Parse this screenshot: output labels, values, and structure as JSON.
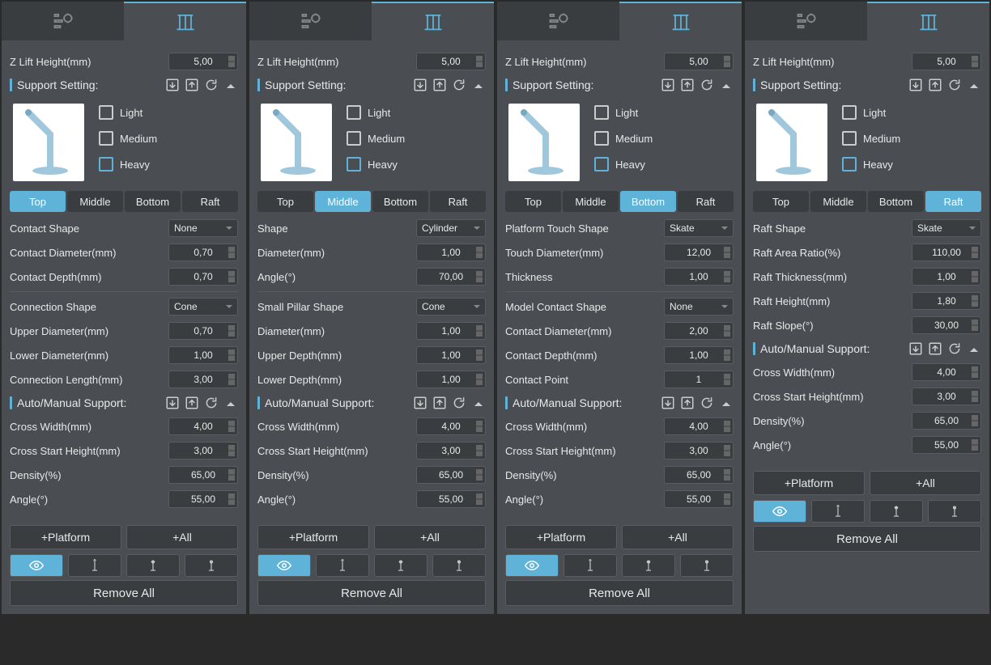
{
  "common": {
    "z_lift_label": "Z Lift Height(mm)",
    "z_lift_value": "5,00",
    "support_setting_label": "Support Setting:",
    "light": "Light",
    "medium": "Medium",
    "heavy": "Heavy",
    "tabs": {
      "top": "Top",
      "middle": "Middle",
      "bottom": "Bottom",
      "raft": "Raft"
    },
    "auto_manual_label": "Auto/Manual Support:",
    "cross_width_label": "Cross Width(mm)",
    "cross_width_value": "4,00",
    "cross_start_label": "Cross Start Height(mm)",
    "cross_start_value": "3,00",
    "density_label": "Density(%)",
    "density_value": "65,00",
    "angle_label": "Angle(°)",
    "angle_value": "55,00",
    "btn_platform": "+Platform",
    "btn_all": "+All",
    "btn_remove": "Remove All"
  },
  "panels": [
    {
      "active_tab": "top",
      "fields": [
        {
          "label": "Contact Shape",
          "type": "select",
          "value": "None"
        },
        {
          "label": "Contact Diameter(mm)",
          "type": "spin",
          "value": "0,70"
        },
        {
          "label": "Contact Depth(mm)",
          "type": "spin",
          "value": "0,70"
        },
        {
          "divider": true
        },
        {
          "label": "Connection Shape",
          "type": "select",
          "value": "Cone"
        },
        {
          "label": "Upper Diameter(mm)",
          "type": "spin",
          "value": "0,70"
        },
        {
          "label": "Lower Diameter(mm)",
          "type": "spin",
          "value": "1,00"
        },
        {
          "label": "Connection Length(mm)",
          "type": "spin",
          "value": "3,00"
        }
      ]
    },
    {
      "active_tab": "middle",
      "fields": [
        {
          "label": "Shape",
          "type": "select",
          "value": "Cylinder"
        },
        {
          "label": "Diameter(mm)",
          "type": "spin",
          "value": "1,00"
        },
        {
          "label": "Angle(°)",
          "type": "spin",
          "value": "70,00"
        },
        {
          "divider": true
        },
        {
          "label": "Small Pillar Shape",
          "type": "select",
          "value": "Cone"
        },
        {
          "label": "Diameter(mm)",
          "type": "spin",
          "value": "1,00"
        },
        {
          "label": "Upper Depth(mm)",
          "type": "spin",
          "value": "1,00"
        },
        {
          "label": "Lower Depth(mm)",
          "type": "spin",
          "value": "1,00"
        }
      ]
    },
    {
      "active_tab": "bottom",
      "fields": [
        {
          "label": "Platform Touch Shape",
          "type": "select",
          "value": "Skate"
        },
        {
          "label": "Touch Diameter(mm)",
          "type": "spin",
          "value": "12,00"
        },
        {
          "label": "Thickness",
          "type": "spin",
          "value": "1,00"
        },
        {
          "divider": true
        },
        {
          "label": "Model Contact Shape",
          "type": "select",
          "value": "None"
        },
        {
          "label": "Contact Diameter(mm)",
          "type": "spin",
          "value": "2,00"
        },
        {
          "label": "Contact Depth(mm)",
          "type": "spin",
          "value": "1,00"
        },
        {
          "label": "Contact Point",
          "type": "spin",
          "value": "1"
        }
      ]
    },
    {
      "active_tab": "raft",
      "fields": [
        {
          "label": "Raft Shape",
          "type": "select",
          "value": "Skate"
        },
        {
          "label": "Raft Area Ratio(%)",
          "type": "spin",
          "value": "110,00"
        },
        {
          "label": "Raft Thickness(mm)",
          "type": "spin",
          "value": "1,00"
        },
        {
          "label": "Raft Height(mm)",
          "type": "spin",
          "value": "1,80"
        },
        {
          "label": "Raft Slope(°)",
          "type": "spin",
          "value": "30,00"
        }
      ]
    }
  ]
}
